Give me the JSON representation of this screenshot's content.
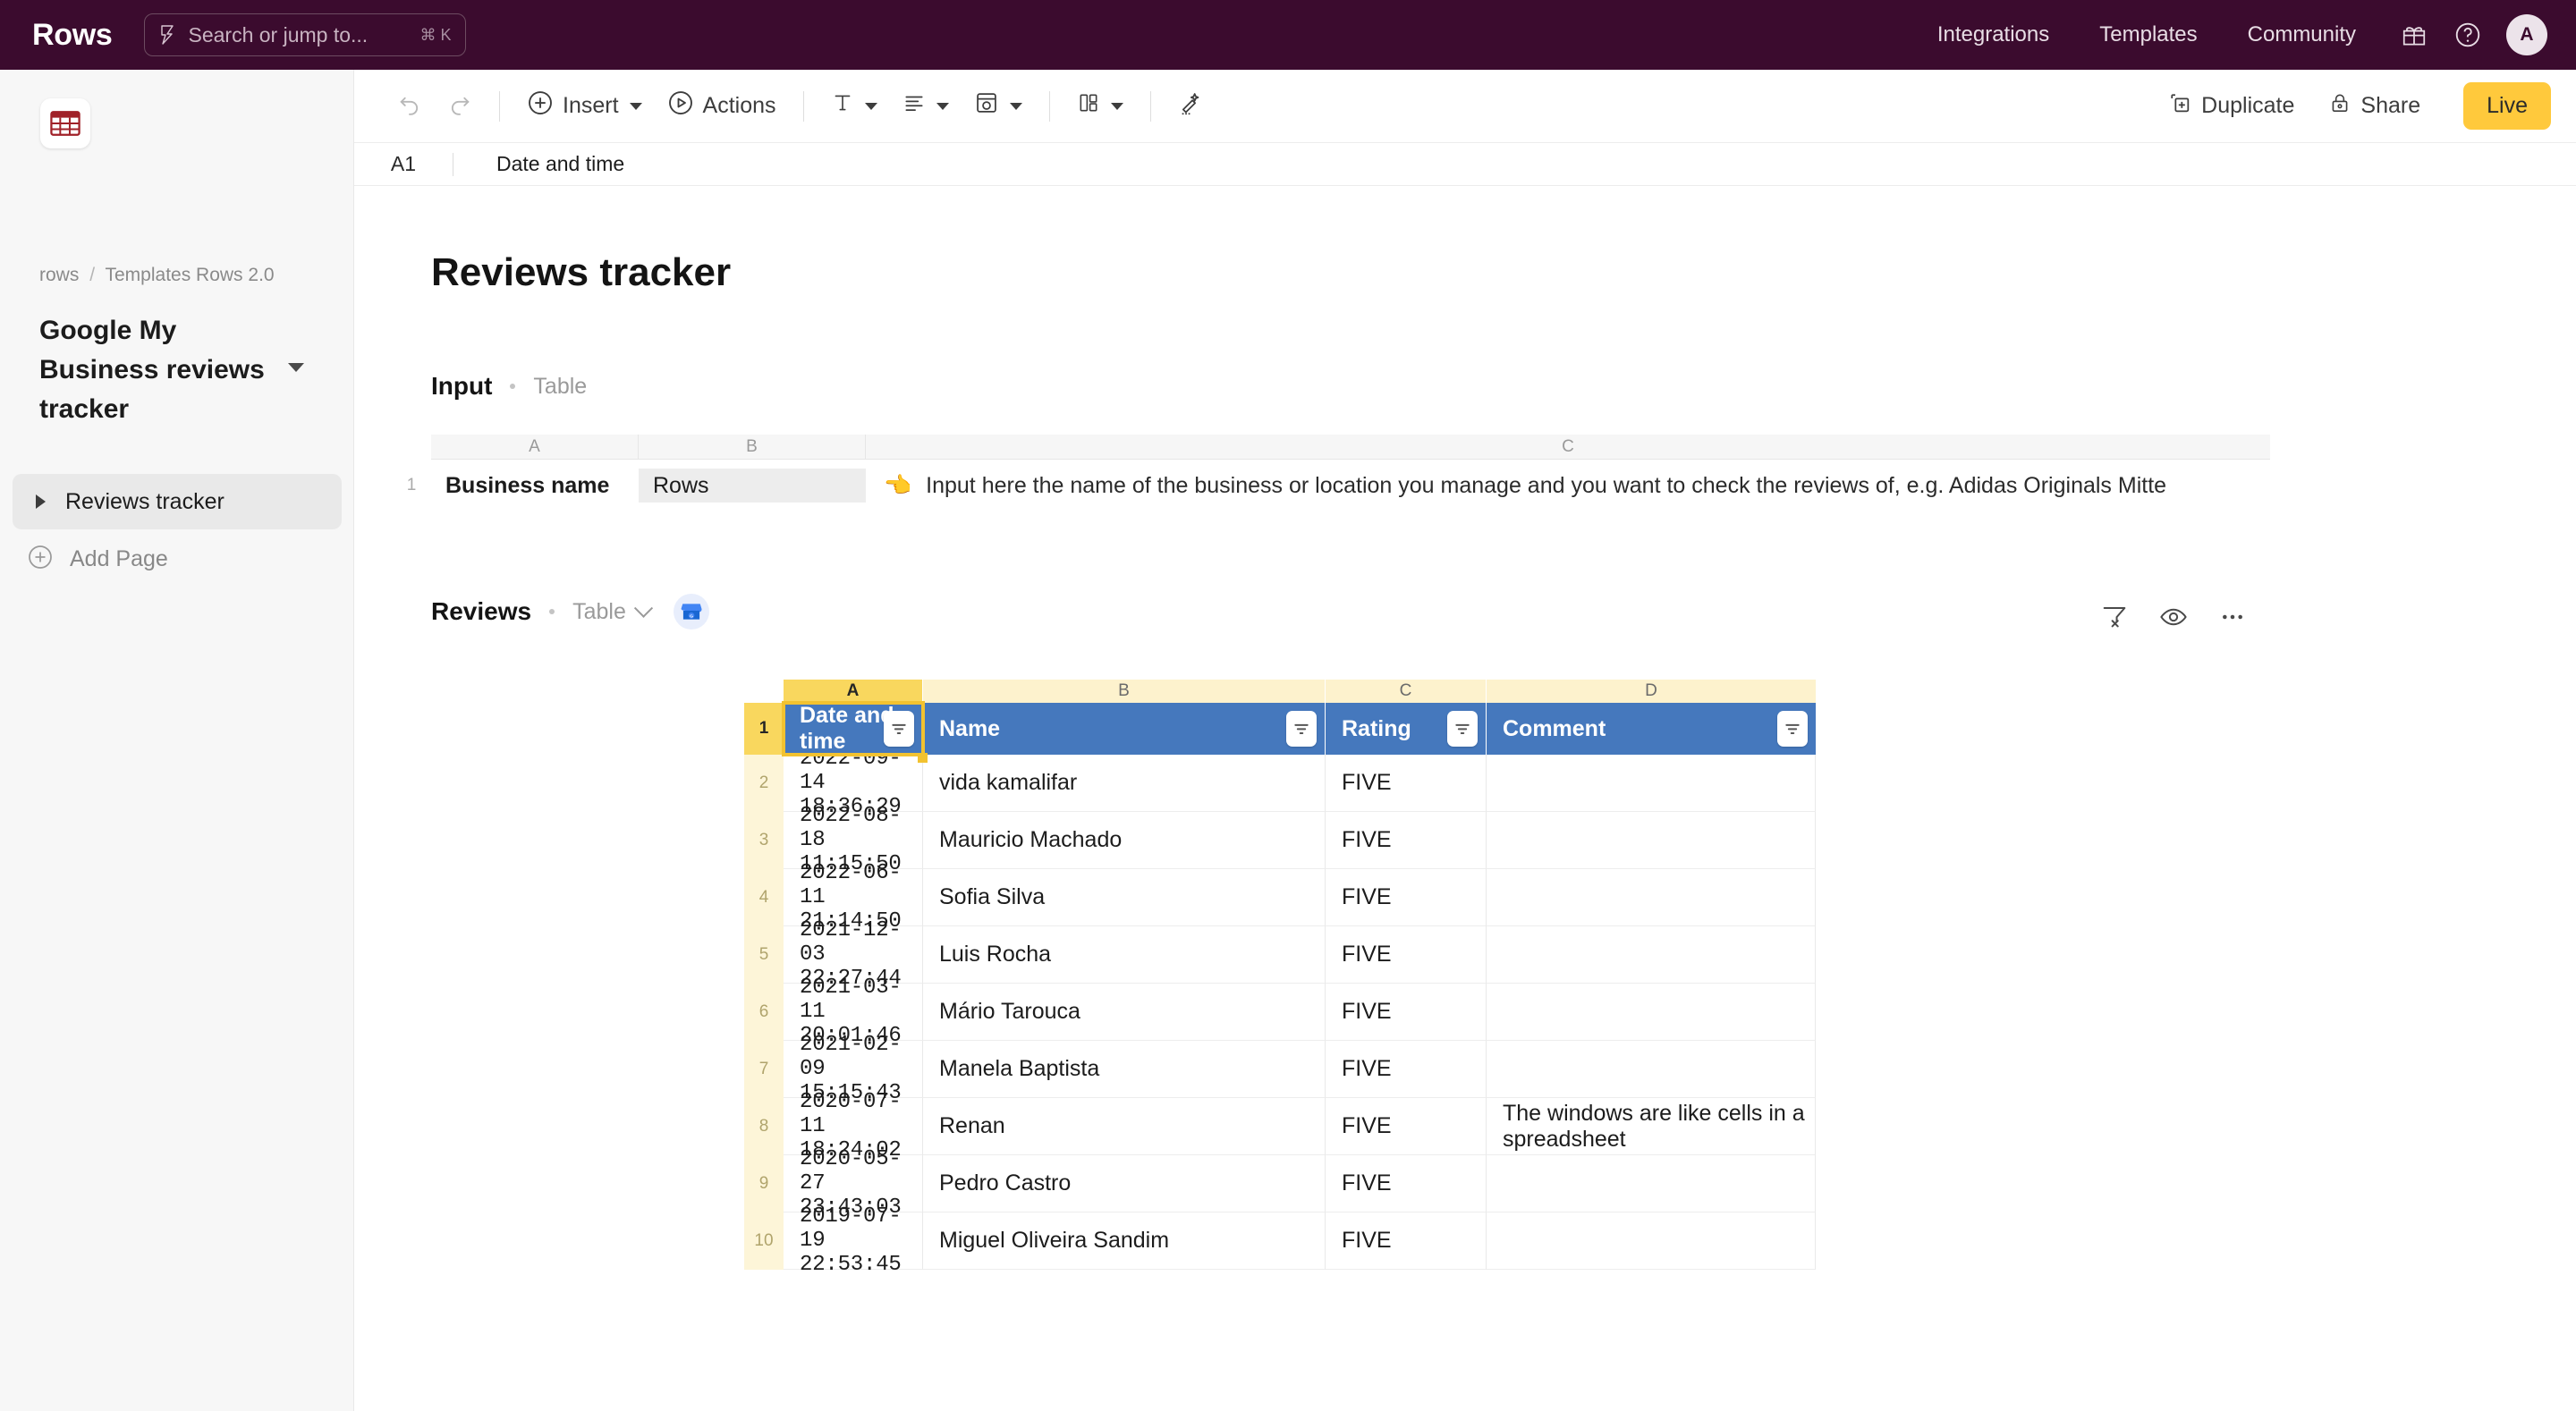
{
  "topbar": {
    "brand": "Rows",
    "search": {
      "placeholder": "Search or jump to...",
      "shortcut": "⌘ K",
      "icon": "lightning-bolt-icon"
    },
    "nav": [
      {
        "label": "Integrations"
      },
      {
        "label": "Templates"
      },
      {
        "label": "Community"
      }
    ],
    "gift_icon": "gift-icon",
    "help_icon": "help-circle-icon",
    "avatar_initial": "A",
    "background_color": "#3B0B2E"
  },
  "sidebar": {
    "app_icon": "spreadsheet-icon",
    "breadcrumb": {
      "workspace": "rows",
      "separator": "/",
      "folder": "Templates Rows 2.0"
    },
    "document_title": "Google My Business reviews tracker",
    "pages": [
      {
        "label": "Reviews tracker",
        "selected": true
      }
    ],
    "add_page_label": "Add Page"
  },
  "toolbar": {
    "undo_icon": "undo-icon",
    "redo_icon": "redo-icon",
    "insert_label": "Insert",
    "actions_label": "Actions",
    "text_format_icon": "text-format-icon",
    "align_icon": "align-icon",
    "cell_style_icon": "cell-style-icon",
    "layout_icon": "layout-icon",
    "clear_format_icon": "clear-format-icon",
    "duplicate_label": "Duplicate",
    "share_label": "Share",
    "live_label": "Live",
    "live_color": "#FFC93C"
  },
  "formula_bar": {
    "cell_reference": "A1",
    "value": "Date and time"
  },
  "sheet": {
    "title": "Reviews tracker"
  },
  "input_section": {
    "name": "Input",
    "type": "Table",
    "column_headers": [
      "A",
      "B",
      "C"
    ],
    "row_number": "1",
    "label": "Business name",
    "value": "Rows",
    "hint_emoji": "👈",
    "hint_text": "Input here the name of the business or location you manage and you want to check the reviews of, e.g. Adidas Originals Mitte"
  },
  "reviews_section": {
    "name": "Reviews",
    "type": "Table",
    "integration_icon": "google-my-business-icon",
    "tools": [
      {
        "icon": "filter-off-icon",
        "name": "clear-filters"
      },
      {
        "icon": "eye-icon",
        "name": "hidden-columns"
      },
      {
        "icon": "more-horizontal-icon",
        "name": "more-options"
      }
    ],
    "column_headers": [
      "A",
      "B",
      "C",
      "D"
    ],
    "header_row_number": "1",
    "headers": [
      "Date and time",
      "Name",
      "Rating",
      "Comment"
    ],
    "header_background": "#4578bd",
    "selected_cell": "A1",
    "rows": [
      {
        "n": "2",
        "date": "2022-09-14 18:36:29",
        "name": "vida kamalifar",
        "rating": "FIVE",
        "comment": ""
      },
      {
        "n": "3",
        "date": "2022-08-18 11:15:50",
        "name": "Mauricio Machado",
        "rating": "FIVE",
        "comment": ""
      },
      {
        "n": "4",
        "date": "2022-06-11 21:14:50",
        "name": "Sofia Silva",
        "rating": "FIVE",
        "comment": ""
      },
      {
        "n": "5",
        "date": "2021-12-03 22:27:44",
        "name": "Luis Rocha",
        "rating": "FIVE",
        "comment": ""
      },
      {
        "n": "6",
        "date": "2021-03-11 20:01:46",
        "name": "Mário Tarouca",
        "rating": "FIVE",
        "comment": ""
      },
      {
        "n": "7",
        "date": "2021-02-09 15:15:43",
        "name": "Manela Baptista",
        "rating": "FIVE",
        "comment": ""
      },
      {
        "n": "8",
        "date": "2020-07-11 18:24:02",
        "name": "Renan",
        "rating": "FIVE",
        "comment": "The windows are like cells in a spreadsheet"
      },
      {
        "n": "9",
        "date": "2020-05-27 23:43:03",
        "name": "Pedro Castro",
        "rating": "FIVE",
        "comment": ""
      },
      {
        "n": "10",
        "date": "2019-07-19 22:53:45",
        "name": "Miguel Oliveira Sandim",
        "rating": "FIVE",
        "comment": ""
      }
    ]
  }
}
